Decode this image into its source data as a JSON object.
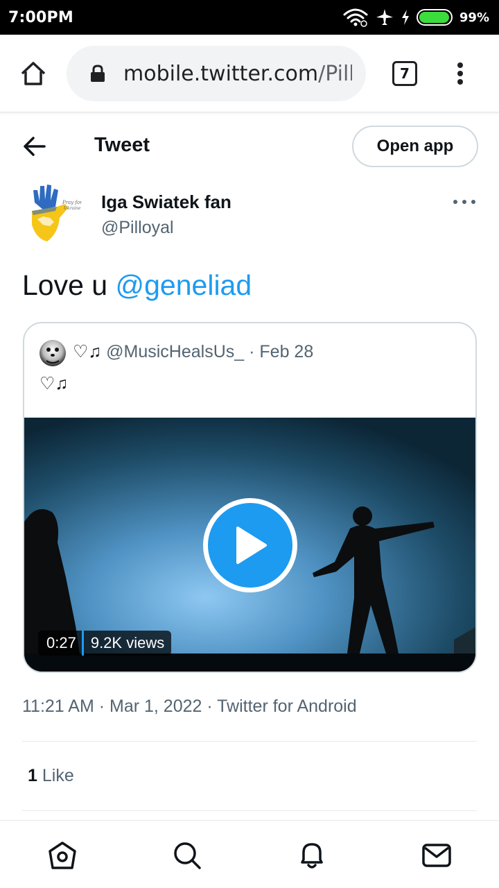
{
  "status_bar": {
    "time": "7:00PM",
    "battery_percent": "99%",
    "battery_level": 0.99,
    "icons": [
      "wifi-icon",
      "airplane-icon",
      "charging-icon",
      "battery-icon"
    ]
  },
  "browser": {
    "url_host": "mobile.twitter.com",
    "url_path": "/Pilloyal",
    "tab_count": "7"
  },
  "header": {
    "title": "Tweet",
    "open_app_label": "Open app"
  },
  "tweet": {
    "author_name": "Iga Swiatek fan",
    "author_handle": "@Pilloyal",
    "text_prefix": "Love u ",
    "mention": "@geneliad",
    "quote": {
      "author_name": "♡♫",
      "author_handle": "@MusicHealsUs_",
      "date": "· Feb 28",
      "text": "♡♫",
      "video": {
        "duration": "0:27",
        "views": "9.2K views"
      }
    },
    "timestamp": "11:21 AM · Mar 1, 2022 · Twitter for Android",
    "likes_count": "1",
    "likes_label": "Like"
  },
  "colors": {
    "accent": "#1d9bf0",
    "text_primary": "#0f1419",
    "text_secondary": "#536471",
    "border": "#cfd9de"
  },
  "bottom_nav": [
    "home-icon",
    "search-icon",
    "notifications-icon",
    "messages-icon"
  ]
}
